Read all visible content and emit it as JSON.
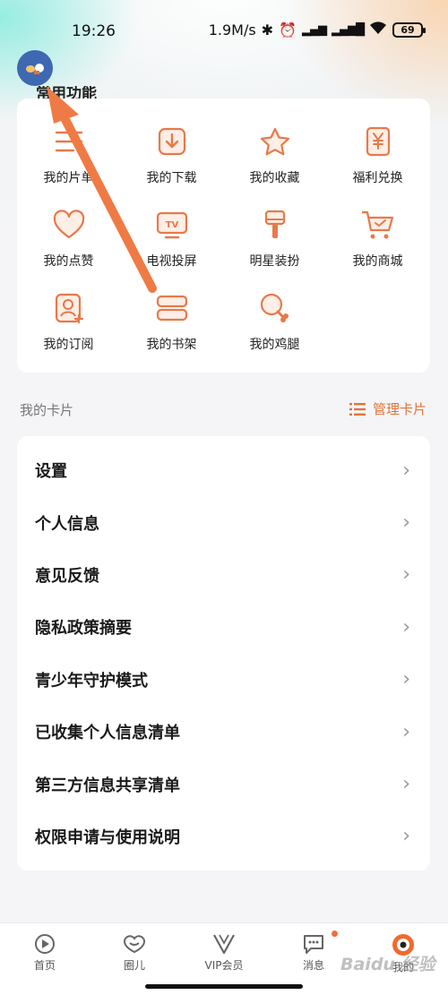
{
  "status_bar": {
    "time": "19:26",
    "speed": "1.9M/s",
    "battery": "69"
  },
  "section_title": "常用功能",
  "functions": [
    {
      "label": "我的片单",
      "icon": "list-icon"
    },
    {
      "label": "我的下载",
      "icon": "download-icon"
    },
    {
      "label": "我的收藏",
      "icon": "star-icon"
    },
    {
      "label": "福利兑换",
      "icon": "yen-icon"
    },
    {
      "label": "我的点赞",
      "icon": "heart-icon"
    },
    {
      "label": "电视投屏",
      "icon": "tv-icon"
    },
    {
      "label": "明星装扮",
      "icon": "brush-icon"
    },
    {
      "label": "我的商城",
      "icon": "cart-icon"
    },
    {
      "label": "我的订阅",
      "icon": "subscribe-icon"
    },
    {
      "label": "我的书架",
      "icon": "books-icon"
    },
    {
      "label": "我的鸡腿",
      "icon": "drumstick-icon"
    }
  ],
  "cards": {
    "title": "我的卡片",
    "manage_label": "管理卡片"
  },
  "menu": [
    {
      "label": "设置"
    },
    {
      "label": "个人信息"
    },
    {
      "label": "意见反馈"
    },
    {
      "label": "隐私政策摘要"
    },
    {
      "label": "青少年守护模式"
    },
    {
      "label": "已收集个人信息清单"
    },
    {
      "label": "第三方信息共享清单"
    },
    {
      "label": "权限申请与使用说明"
    }
  ],
  "bottom_nav": [
    {
      "label": "首页",
      "icon": "home-play-icon"
    },
    {
      "label": "圈儿",
      "icon": "circle-icon"
    },
    {
      "label": "VIP会员",
      "icon": "vip-icon"
    },
    {
      "label": "消息",
      "icon": "message-icon"
    },
    {
      "label": "我的",
      "icon": "profile-icon"
    }
  ],
  "watermark": "Baidu 经验",
  "colors": {
    "accent": "#e0743a",
    "arrow": "#f07a45",
    "avatar_bg": "#3f68b2"
  }
}
